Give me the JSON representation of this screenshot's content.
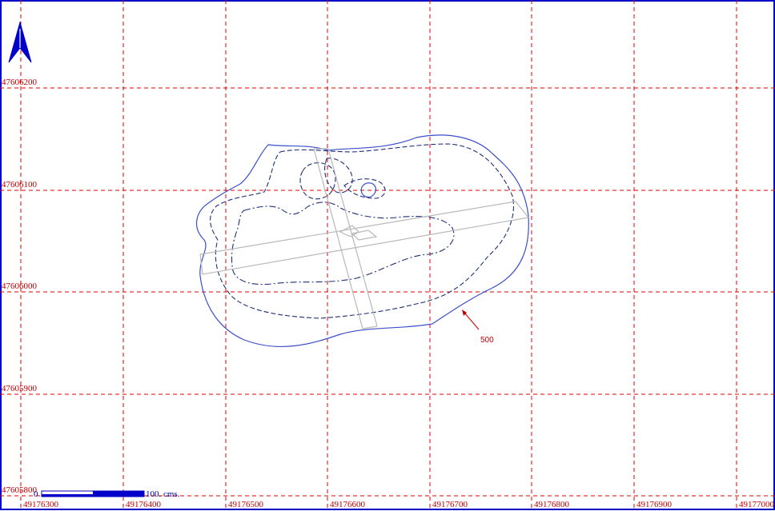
{
  "map": {
    "x_labels": [
      "49176300",
      "49176400",
      "49176500",
      "49176600",
      "49176700",
      "49176800",
      "49176900",
      "49177000"
    ],
    "y_labels": [
      "47606200",
      "47606100",
      "47606000",
      "47605900",
      "47605800"
    ],
    "contour_label": "500",
    "scale": {
      "start_label": "0",
      "end_label": "100. cms."
    },
    "north_arrow": "north-arrow-icon",
    "colors": {
      "grid": "#e00000",
      "contour": "#3b4fc8",
      "contour_dashed": "#1f2f7a",
      "runway": "#b8b8b8",
      "label": "#c00000",
      "north_arrow": "#0000c8"
    }
  }
}
